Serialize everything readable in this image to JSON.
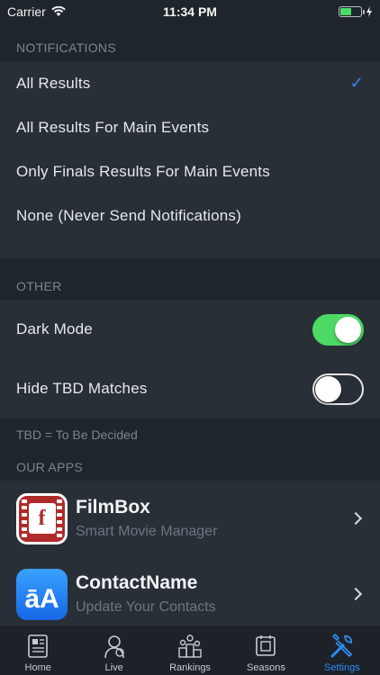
{
  "status_bar": {
    "carrier": "Carrier",
    "time": "11:34 PM",
    "battery_level": 0.55
  },
  "notifications": {
    "header": "NOTIFICATIONS",
    "options": [
      {
        "label": "All Results",
        "selected": true
      },
      {
        "label": "All Results For Main Events",
        "selected": false
      },
      {
        "label": "Only Finals Results For Main Events",
        "selected": false
      },
      {
        "label": "None (Never Send Notifications)",
        "selected": false
      }
    ],
    "check_mark": "✓"
  },
  "other": {
    "header": "OTHER",
    "dark_mode": {
      "label": "Dark Mode",
      "on": true
    },
    "hide_tbd": {
      "label": "Hide TBD Matches",
      "on": false
    },
    "footer": "TBD = To Be Decided"
  },
  "our_apps": {
    "header": "OUR APPS",
    "apps": [
      {
        "name": "FilmBox",
        "subtitle": "Smart Movie Manager",
        "icon_letter": "f"
      },
      {
        "name": "ContactName",
        "subtitle": "Update Your Contacts",
        "icon_letter": "āA"
      }
    ]
  },
  "tabs": [
    {
      "label": "Home",
      "icon": "home-newspaper-icon",
      "active": false
    },
    {
      "label": "Live",
      "icon": "live-player-icon",
      "active": false
    },
    {
      "label": "Rankings",
      "icon": "rankings-podium-icon",
      "active": false
    },
    {
      "label": "Seasons",
      "icon": "seasons-calendar-icon",
      "active": false
    },
    {
      "label": "Settings",
      "icon": "settings-tools-icon",
      "active": true
    }
  ],
  "colors": {
    "accent": "#2f8cf5",
    "toggle_on": "#4cd964",
    "background": "#1f252c",
    "cell": "#292f37"
  }
}
